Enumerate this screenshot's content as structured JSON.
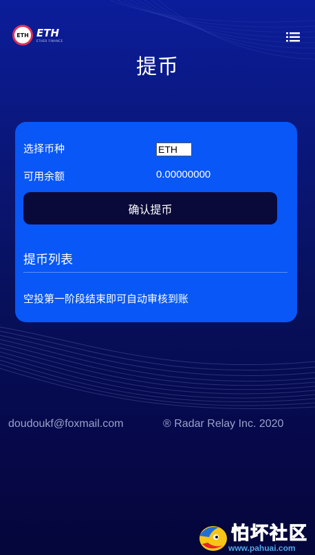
{
  "header": {
    "logo_text": "ETH",
    "logo_subtext": "ETHER FINANCE",
    "menu_icon": "menu-list-icon",
    "title": "提币"
  },
  "withdraw_card": {
    "coin_label": "选择币种",
    "coin_selected": "ETH",
    "balance_label": "可用余额",
    "balance_value": "0.00000000",
    "confirm_button": "确认提币",
    "list_title": "提币列表",
    "notice": "空投第一阶段结束即可自动审核到账"
  },
  "footer": {
    "email": "doudoukf@foxmail.com",
    "copyright": "® Radar Relay Inc. 2020"
  },
  "watermark": {
    "title": "怕坏社区",
    "url": "www.pahuai.com"
  },
  "colors": {
    "card_bg": "#0857f6",
    "button_bg": "#0a0a3a",
    "page_bg_top": "#0b1d9a",
    "page_bg_bottom": "#05063a",
    "footer_text": "#9aa2c8"
  }
}
